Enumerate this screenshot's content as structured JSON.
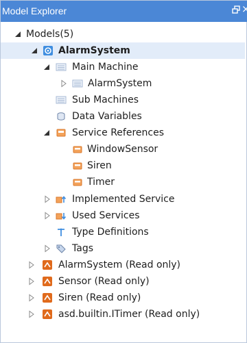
{
  "window": {
    "title": "Model Explorer",
    "pin_icon": "pin-icon",
    "close_glyph": "×"
  },
  "tree": {
    "root": {
      "label": "Models(5)"
    },
    "alarm_system": {
      "label": "AlarmSystem",
      "selected": true
    },
    "main_machine": {
      "label": "Main Machine"
    },
    "main_alarm": {
      "label": "AlarmSystem"
    },
    "sub_machines": {
      "label": "Sub Machines"
    },
    "data_variables": {
      "label": "Data Variables"
    },
    "service_references": {
      "label": "Service References"
    },
    "window_sensor": {
      "label": "WindowSensor"
    },
    "siren": {
      "label": "Siren"
    },
    "timer": {
      "label": "Timer"
    },
    "implemented_service": {
      "label": "Implemented Service"
    },
    "used_services": {
      "label": "Used Services"
    },
    "type_definitions": {
      "label": "Type Definitions"
    },
    "tags": {
      "label": "Tags"
    },
    "model_alarm": {
      "label": "AlarmSystem (Read only)"
    },
    "model_sensor": {
      "label": "Sensor (Read only)"
    },
    "model_siren": {
      "label": "Siren (Read only)"
    },
    "model_itimer": {
      "label": "asd.builtin.ITimer (Read only)"
    }
  },
  "colors": {
    "title_bar": "#4b87d6",
    "selection": "#e2ecf9",
    "read_only_model": "#e06a1c",
    "model_icon": "#3f8ee0"
  }
}
